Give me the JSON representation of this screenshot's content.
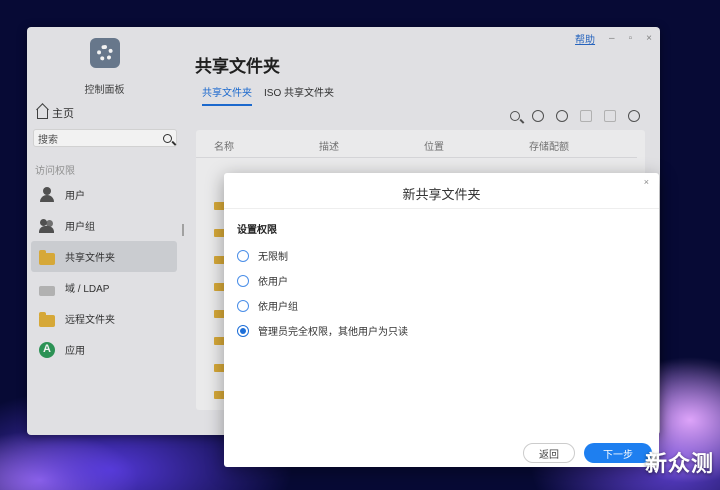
{
  "window": {
    "help_link": "帮助",
    "minimize": "–",
    "maximize": "▫",
    "close": "×"
  },
  "sidebar": {
    "app_name": "控制面板",
    "home_label": "主页",
    "search_placeholder": "搜索",
    "section_label": "访问权限",
    "items": [
      {
        "label": "用户",
        "icon": "user-icon"
      },
      {
        "label": "用户组",
        "icon": "user-group-icon"
      },
      {
        "label": "共享文件夹",
        "icon": "shared-folder-icon",
        "active": true
      },
      {
        "label": "域 / LDAP",
        "icon": "ldap-icon"
      },
      {
        "label": "远程文件夹",
        "icon": "remote-folder-icon"
      },
      {
        "label": "应用",
        "icon": "app-icon"
      }
    ]
  },
  "main": {
    "title": "共享文件夹",
    "tabs": [
      {
        "label": "共享文件夹",
        "active": true
      },
      {
        "label": "ISO 共享文件夹",
        "active": false
      }
    ],
    "table_headers": [
      "名称",
      "描述",
      "位置",
      "存储配额"
    ]
  },
  "dialog": {
    "title": "新共享文件夹",
    "close": "×",
    "section_title": "设置权限",
    "options": [
      {
        "label": "无限制",
        "checked": false
      },
      {
        "label": "依用户",
        "checked": false
      },
      {
        "label": "依用户组",
        "checked": false
      },
      {
        "label": "管理员完全权限，其他用户为只读",
        "checked": true
      }
    ],
    "back_label": "返回",
    "next_label": "下一步"
  },
  "watermark": "新众测",
  "colors": {
    "accent": "#1e6fd8",
    "folder": "#e2b13c"
  }
}
